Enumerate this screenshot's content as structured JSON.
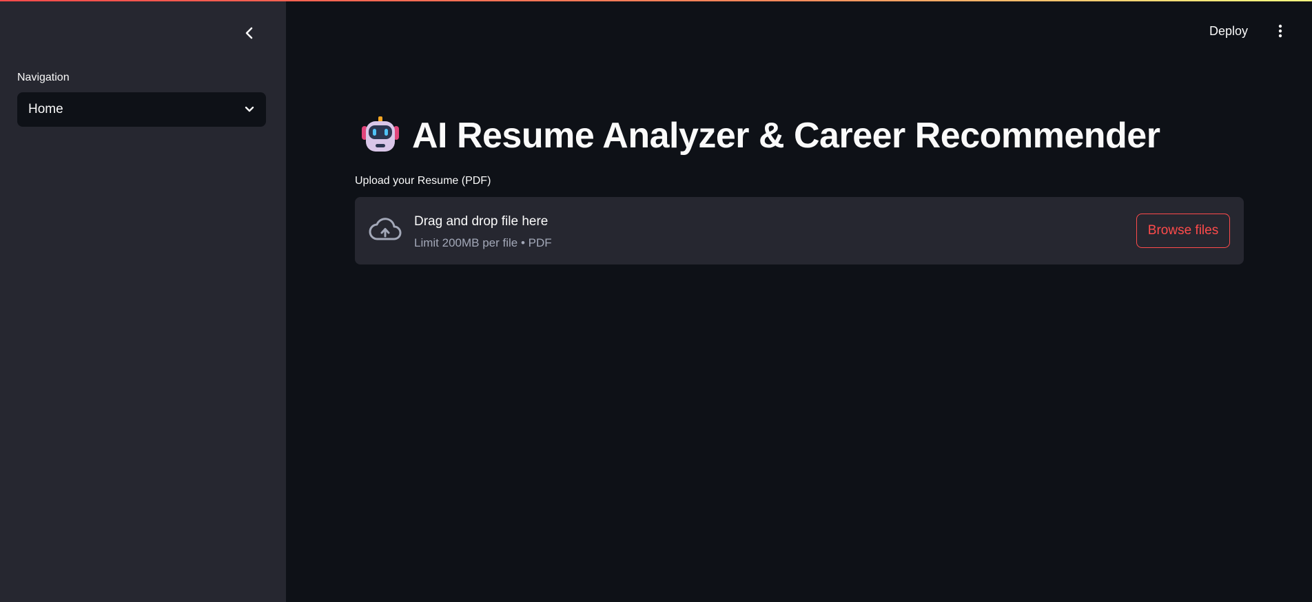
{
  "sidebar": {
    "navigation_label": "Navigation",
    "selected_page": "Home"
  },
  "header": {
    "deploy_label": "Deploy"
  },
  "main": {
    "title": "AI Resume Analyzer & Career Recommender",
    "upload": {
      "label": "Upload your Resume (PDF)",
      "dropzone_title": "Drag and drop file here",
      "dropzone_subtitle": "Limit 200MB per file • PDF",
      "browse_label": "Browse files"
    }
  },
  "icons": {
    "collapse": "chevron-left-icon",
    "select": "chevron-down-icon",
    "menu": "kebab-menu-icon",
    "title": "robot-icon",
    "upload": "cloud-upload-icon"
  },
  "colors": {
    "background": "#0e1117",
    "sidebar": "#262730",
    "accent": "#ff4b4b",
    "text": "#fafafa",
    "muted_text": "#a3a8b8"
  }
}
